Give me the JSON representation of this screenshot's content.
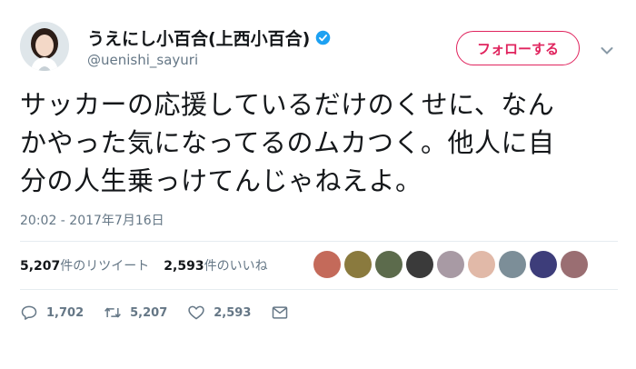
{
  "user": {
    "display_name": "うえにし小百合(上西小百合)",
    "handle": "@uenishi_sayuri"
  },
  "follow_button_label": "フォローする",
  "tweet_text": "サッカーの応援しているだけのくせに、なん\nかやった気になってるのムカつく。他人に自\n分の人生乗っけてんじゃねえよ。",
  "timestamp": "20:02 - 2017年7月16日",
  "stats": {
    "retweets_count": "5,207",
    "retweets_label": "件のリツイート",
    "likes_count": "2,593",
    "likes_label": "件のいいね"
  },
  "actions": {
    "reply_count": "1,702",
    "retweet_count": "5,207",
    "like_count": "2,593"
  },
  "colors": {
    "accent": "#e0245e",
    "verified": "#1da1f2",
    "muted": "#657786"
  },
  "icons": [
    "verified-icon",
    "chevron-down-icon",
    "reply-icon",
    "retweet-icon",
    "like-icon",
    "message-icon"
  ]
}
